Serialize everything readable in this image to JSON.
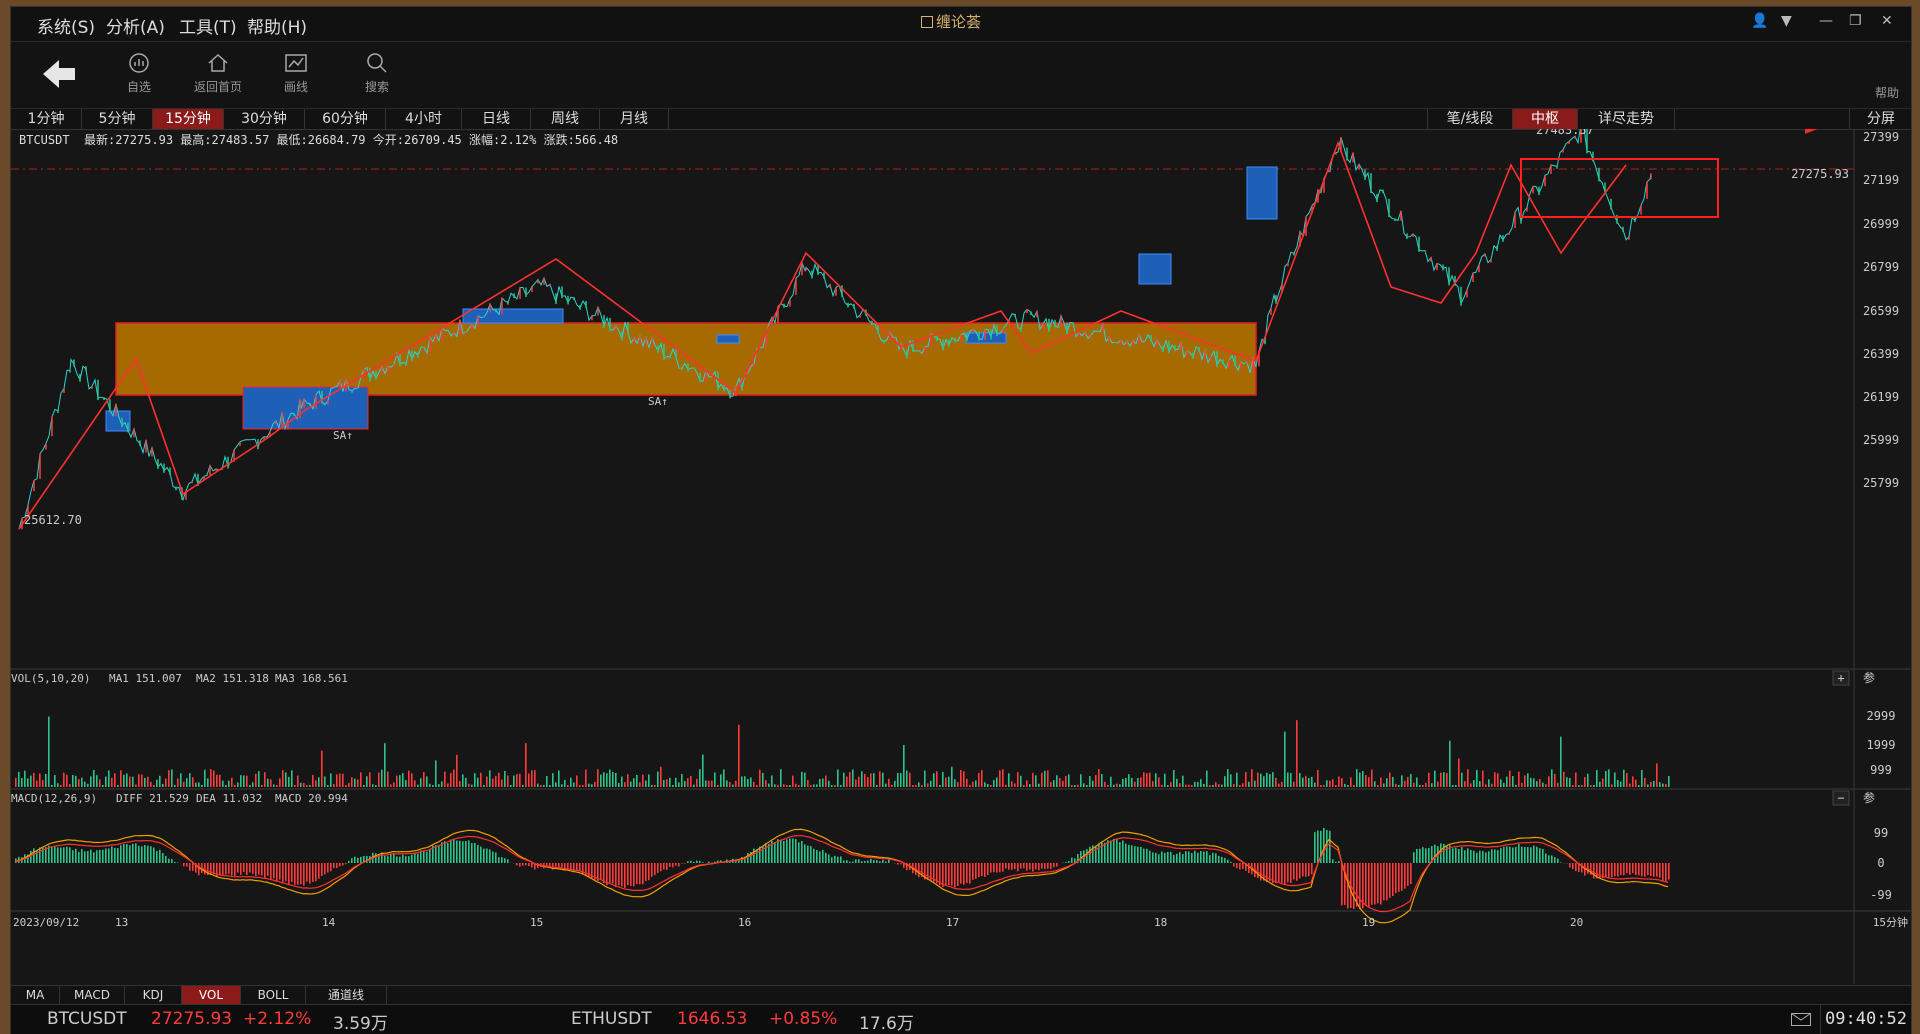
{
  "menu": {
    "items": [
      "系统(S)",
      "分析(A)",
      "工具(T)",
      "帮助(H)"
    ],
    "title": "缠论荟"
  },
  "toolbar": {
    "items": [
      "自选",
      "返回首页",
      "画线",
      "搜索"
    ],
    "help": "帮助"
  },
  "period_tabs": {
    "items": [
      "1分钟",
      "5分钟",
      "15分钟",
      "30分钟",
      "60分钟",
      "4小时",
      "日线",
      "周线",
      "月线"
    ],
    "active": "15分钟"
  },
  "right_tabs": {
    "items": [
      "笔/线段",
      "中枢",
      "详尽走势"
    ],
    "active": "中枢",
    "split": "分屏"
  },
  "quote_line": "BTCUSDT  最新:27275.93 最高:27483.57 最低:26684.79 今开:26709.45 涨幅:2.12% 涨跌:566.48",
  "main_chart": {
    "y_axis_labels": [
      "27399",
      "27199",
      "26999",
      "26799",
      "26599",
      "26399",
      "26199",
      "25999",
      "25799"
    ],
    "current_price_label": "27275.93",
    "high_label": "27483.57",
    "low_label": "25612.70",
    "signals": [
      "SA↑",
      "SA↑"
    ]
  },
  "volume_panel": {
    "header": [
      "VOL(5,10,20)",
      "MA1 151.007",
      "MA2 151.318",
      "MA3 168.561"
    ],
    "y_labels": [
      "2999",
      "1999",
      "999"
    ],
    "buttons": [
      "+",
      "参"
    ]
  },
  "macd_panel": {
    "header": [
      "MACD(12,26,9)",
      "DIFF 21.529",
      "DEA 11.032",
      "MACD 20.994"
    ],
    "y_labels": [
      "99",
      "0",
      "-99"
    ],
    "buttons": [
      "−",
      "参"
    ]
  },
  "time_axis": {
    "labels": [
      "2023/09/12",
      "13",
      "14",
      "15",
      "16",
      "17",
      "18",
      "19",
      "20"
    ],
    "period": "15分钟"
  },
  "indicator_tabs": {
    "items": [
      "MA",
      "MACD",
      "KDJ",
      "VOL",
      "BOLL",
      "通道线"
    ],
    "active": "VOL"
  },
  "status_bar": {
    "sym1": "BTCUSDT",
    "price1": "27275.93",
    "chg1": "+2.12%",
    "vol1": "3.59万",
    "sym2": "ETHUSDT",
    "price2": "1646.53",
    "chg2": "+0.85%",
    "vol2": "17.6万",
    "clock": "09:40:52"
  },
  "colors": {
    "up": "#ff3b3b",
    "down": "#2bd4d4",
    "accent": "#8b1b1b",
    "zone_fill": "#a66a00",
    "box_fill": "#1e5fb8"
  },
  "chart_data": {
    "type": "line",
    "title": "",
    "symbol": "BTCUSDT",
    "period": "15分钟",
    "x": [
      "2023/09/12",
      "13",
      "14",
      "15",
      "16",
      "17",
      "18",
      "19",
      "20"
    ],
    "price_path": [
      25612.7,
      26400,
      25790,
      26180,
      26750,
      26260,
      26850,
      26450,
      26600,
      26380,
      26700,
      27420,
      26710,
      27480,
      26980,
      27275.93
    ],
    "ylim": [
      25612.7,
      27483.57
    ],
    "current": 27275.93,
    "high": 27483.57,
    "low": 25612.7,
    "zones": [
      {
        "name": "central-zone",
        "low": 26180,
        "high": 26540
      },
      {
        "name": "recent-box",
        "low": 27060,
        "high": 27330
      }
    ],
    "volume_ma": {
      "MA1": 151.007,
      "MA2": 151.318,
      "MA3": 168.561
    },
    "macd": {
      "DIFF": 21.529,
      "DEA": 11.032,
      "MACD": 20.994
    }
  }
}
